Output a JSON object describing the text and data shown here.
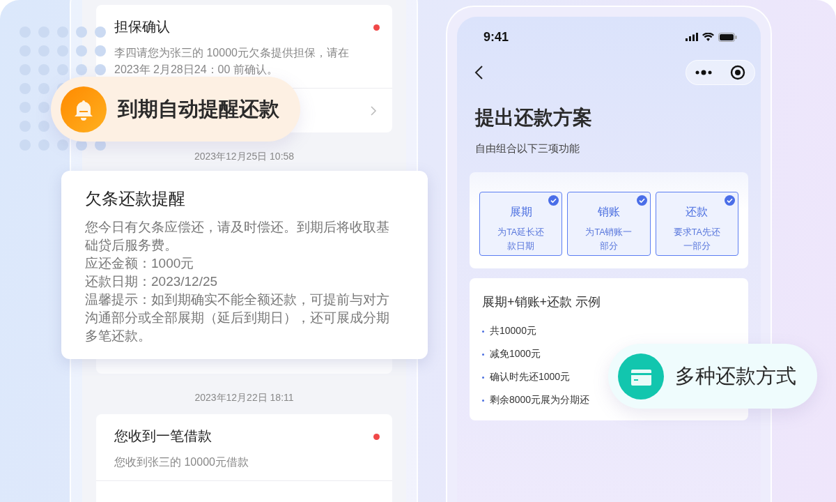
{
  "left_phone": {
    "top_message": {
      "title": "担保确认",
      "body": "李四请您为张三的 10000元欠条提供担保，请在2023年 2月28日24：00 前确认。",
      "unread": true
    },
    "timestamps": [
      "2023年12月25日 10:58",
      "2023年12月22日 18:11"
    ],
    "bottom_message": {
      "title": "您收到一笔借款",
      "body": "您收到张三的 10000元借款",
      "unread": true
    }
  },
  "reminder_popup": {
    "title": "欠条还款提醒",
    "lines": [
      "您今日有欠条应偿还，请及时偿还。到期后将收取基础贷后服务费。",
      "应还金额：1000元",
      "还款日期：2023/12/25",
      "温馨提示：如到期确实不能全额还款，可提前与对方沟通部分或全部展期（延后到期日），还可展成分期多笔还款。"
    ]
  },
  "badges": [
    {
      "kind": "bell",
      "text": "到期自动提醒还款"
    },
    {
      "kind": "card",
      "text": "多种还款方式"
    }
  ],
  "right_phone": {
    "status_time": "9:41",
    "title": "提出还款方案",
    "subtitle": "自由组合以下三项功能",
    "options": [
      {
        "title": "展期",
        "description": "为TA延长还款日期",
        "checked": true
      },
      {
        "title": "销账",
        "description": "为TA销账一部分",
        "checked": true
      },
      {
        "title": "还款",
        "description": "要求TA先还一部分",
        "checked": true
      }
    ],
    "example": {
      "title": "展期+销账+还款 示例",
      "items": [
        "共10000元",
        "减免1000元",
        "确认时先还1000元",
        "剩余8000元展为分期还"
      ]
    }
  }
}
